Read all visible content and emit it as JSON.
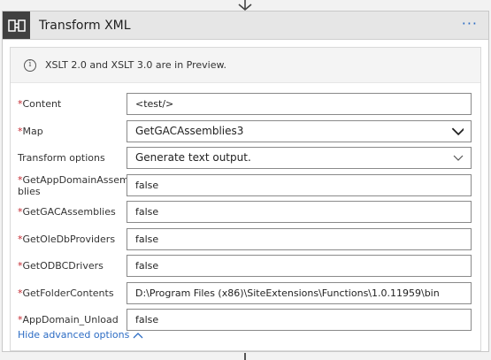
{
  "card": {
    "title": "Transform XML",
    "more_label": "···"
  },
  "banner": {
    "icon_glyph": "i",
    "text": "XSLT 2.0 and XSLT 3.0 are in Preview."
  },
  "fields": [
    {
      "label": "Content",
      "required": true,
      "value": "<test/>",
      "type": "text"
    },
    {
      "label": "Map",
      "required": true,
      "value": "GetGACAssemblies3",
      "type": "select"
    },
    {
      "label": "Transform options",
      "required": false,
      "value": "Generate text output.",
      "type": "select"
    },
    {
      "label": "GetAppDomainAssem blies",
      "required": true,
      "value": "false",
      "type": "text"
    },
    {
      "label": "GetGACAssemblies",
      "required": true,
      "value": "false",
      "type": "text"
    },
    {
      "label": "GetOleDbProviders",
      "required": true,
      "value": "false",
      "type": "text"
    },
    {
      "label": "GetODBCDrivers",
      "required": true,
      "value": "false",
      "type": "text"
    },
    {
      "label": "GetFolderContents",
      "required": true,
      "value": "D:\\Program Files (x86)\\SiteExtensions\\Functions\\1.0.11959\\bin",
      "type": "text"
    },
    {
      "label": "AppDomain_Unload",
      "required": true,
      "value": "false",
      "type": "text"
    }
  ],
  "required_marker": "*",
  "advanced_link": "Hide advanced options",
  "icons": {
    "logo": "transform-xml-logo-icon",
    "info": "info-icon",
    "chevron": "chevron-down-icon",
    "collapse": "chevron-up-icon",
    "arrow": "arrow-down-icon"
  },
  "colors": {
    "header_bg": "#e6e6e6",
    "logo_bg": "#404040",
    "accent": "#2c6cc4",
    "required": "#c4262e"
  }
}
